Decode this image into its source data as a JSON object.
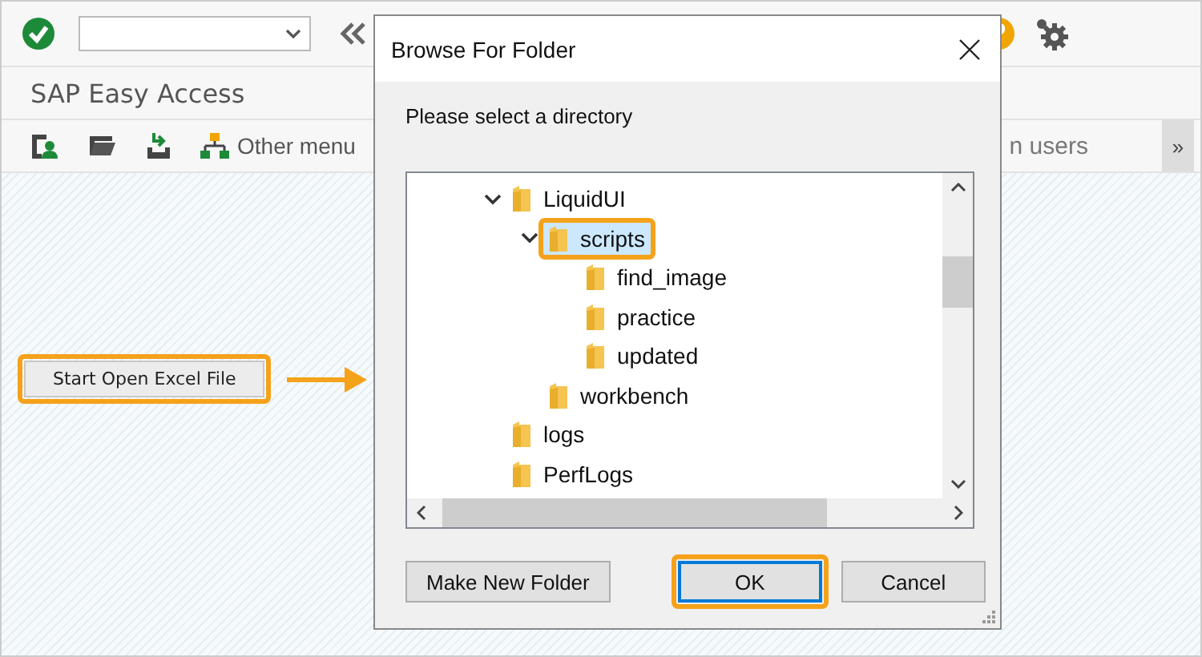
{
  "sap_window": {
    "title": "SAP Easy Access",
    "toolbar": [
      {
        "label": "Other menu"
      }
    ],
    "toolbar_right_text": "n users",
    "more_button": "»",
    "action_button": {
      "label": "Start Open Excel File",
      "highlighted": true
    }
  },
  "dialog": {
    "title": "Browse For Folder",
    "prompt": "Please select a directory",
    "tree": [
      {
        "label": "LiquidUI",
        "expanded": true,
        "selected": false,
        "highlighted": false,
        "children": [
          {
            "label": "scripts",
            "expanded": true,
            "selected": true,
            "highlighted": true,
            "children": [
              {
                "label": "find_image",
                "selected": false,
                "highlighted": false
              },
              {
                "label": "practice",
                "selected": false,
                "highlighted": false
              },
              {
                "label": "updated",
                "selected": false,
                "highlighted": false
              }
            ]
          },
          {
            "label": "workbench",
            "selected": false,
            "highlighted": false
          }
        ]
      },
      {
        "label": "logs",
        "selected": false,
        "highlighted": false
      },
      {
        "label": "PerfLogs",
        "selected": false,
        "highlighted": false
      }
    ],
    "buttons": [
      {
        "label": "Make New Folder",
        "highlighted": false,
        "default": false
      },
      {
        "label": "OK",
        "highlighted": true,
        "default": true
      },
      {
        "label": "Cancel",
        "highlighted": false,
        "default": false
      }
    ]
  }
}
